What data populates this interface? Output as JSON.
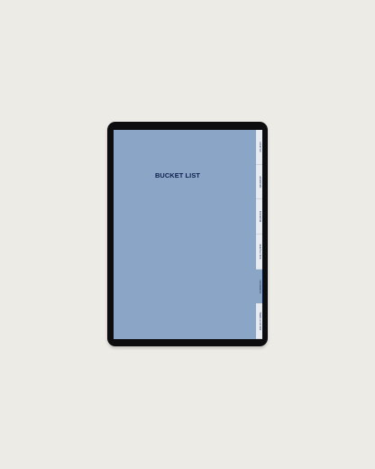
{
  "page": {
    "title": "BUCKET LIST"
  },
  "tabs": [
    {
      "label": "LIFESTYLE",
      "active": false
    },
    {
      "label": "ADVENTURE",
      "active": false
    },
    {
      "label": "EDUCATION",
      "active": false
    },
    {
      "label": "HEALTH & TECH",
      "active": false
    },
    {
      "label": "EXPERIENCES",
      "active": true
    },
    {
      "label": "TRAVEL & CULTURE",
      "active": false
    }
  ],
  "colors": {
    "background": "#edebe6",
    "device_frame": "#0d0d0f",
    "page_blue": "#8aa5c6",
    "title_navy": "#0f1f4d",
    "tab_light": "#e6ebf2"
  }
}
